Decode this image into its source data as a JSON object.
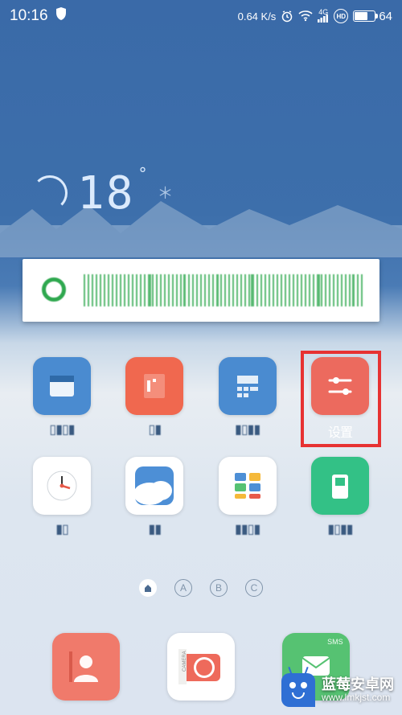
{
  "status": {
    "time": "10:16",
    "net_speed": "0.64 K/s",
    "network_label": "4G",
    "hd_label": "HD",
    "battery_pct": "64"
  },
  "weather": {
    "temp": "18",
    "unit": "°",
    "extra": "＊"
  },
  "apps_row1": [
    {
      "name": "calendar",
      "label": "▯▮▯▮"
    },
    {
      "name": "notes",
      "label": "▯▮"
    },
    {
      "name": "calculator",
      "label": "▮▯▮▮"
    },
    {
      "name": "settings",
      "label": "设置"
    }
  ],
  "apps_row2": [
    {
      "name": "clock",
      "label": "▮▯"
    },
    {
      "name": "weather",
      "label": "▮▮"
    },
    {
      "name": "files",
      "label": "▮▮▯▮"
    },
    {
      "name": "security",
      "label": "▮▯▮▮"
    }
  ],
  "dock": [
    {
      "name": "contacts"
    },
    {
      "name": "camera"
    },
    {
      "name": "sms",
      "badge": "SMS"
    }
  ],
  "page_indicator": {
    "labels": [
      "A",
      "B",
      "C"
    ],
    "active": 0
  },
  "watermark": {
    "title": "蓝莓安卓网",
    "url": "www.lmkjst.com"
  }
}
